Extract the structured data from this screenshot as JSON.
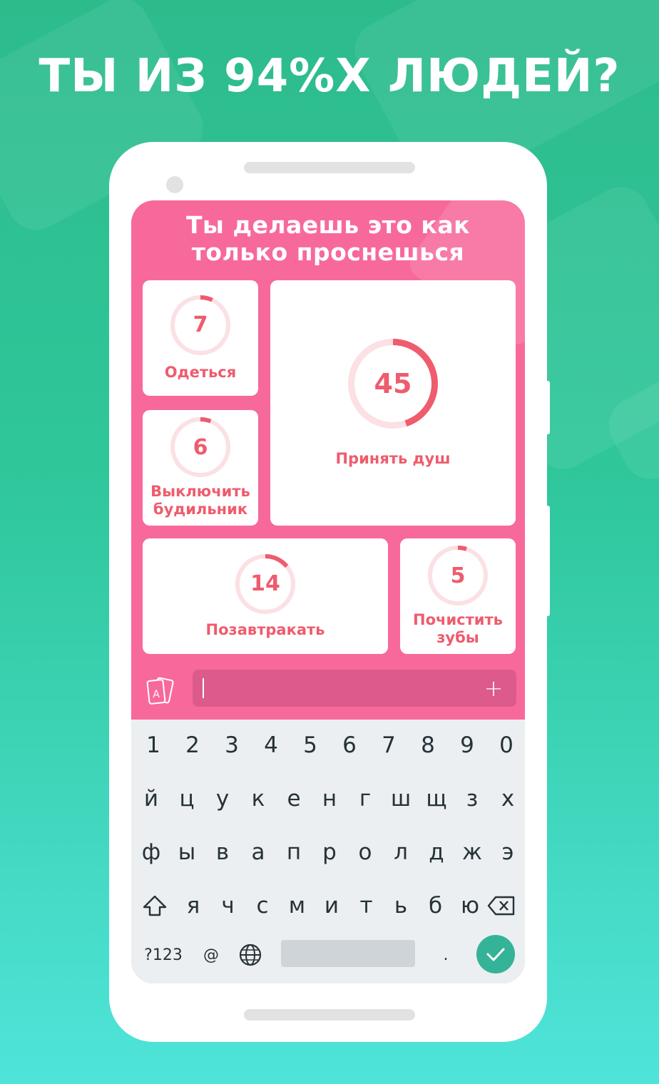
{
  "headline": "ТЫ ИЗ 94%Х ЛЮДЕЙ?",
  "question": {
    "line1": "Ты делаешь это как",
    "line2": "только проснешься"
  },
  "answers": [
    {
      "value": "7",
      "progress": 0.07,
      "label_lines": [
        "Одеться"
      ]
    },
    {
      "value": "45",
      "progress": 0.45,
      "label_lines": [
        "Принять душ"
      ]
    },
    {
      "value": "6",
      "progress": 0.06,
      "label_lines": [
        "Выключить",
        "будильник"
      ]
    },
    {
      "value": "14",
      "progress": 0.14,
      "label_lines": [
        "Позавтракать"
      ]
    },
    {
      "value": "5",
      "progress": 0.05,
      "label_lines": [
        "Почистить",
        "зубы"
      ]
    }
  ],
  "input": {
    "value": "",
    "cards_icon": "cards-icon",
    "add_icon": "plus-icon",
    "add_label": "+"
  },
  "keyboard": {
    "row_numbers": [
      "1",
      "2",
      "3",
      "4",
      "5",
      "6",
      "7",
      "8",
      "9",
      "0"
    ],
    "row1": [
      "й",
      "ц",
      "у",
      "к",
      "е",
      "н",
      "г",
      "ш",
      "щ",
      "з",
      "х"
    ],
    "row2": [
      "ф",
      "ы",
      "в",
      "а",
      "п",
      "р",
      "о",
      "л",
      "д",
      "ж",
      "э"
    ],
    "row3": [
      "я",
      "ч",
      "с",
      "м",
      "и",
      "т",
      "ь",
      "б",
      "ю"
    ],
    "symbols_key": "?123",
    "at_key": "@",
    "period_key": ".",
    "shift_icon": "shift-icon",
    "backspace_icon": "backspace-icon",
    "globe_icon": "globe-icon",
    "enter_icon": "checkmark-icon"
  },
  "colors": {
    "screen_bg": "#f7699b",
    "accent": "#ee5c6d",
    "ring_track": "#fbe0e4",
    "enter_key": "#35b398"
  }
}
